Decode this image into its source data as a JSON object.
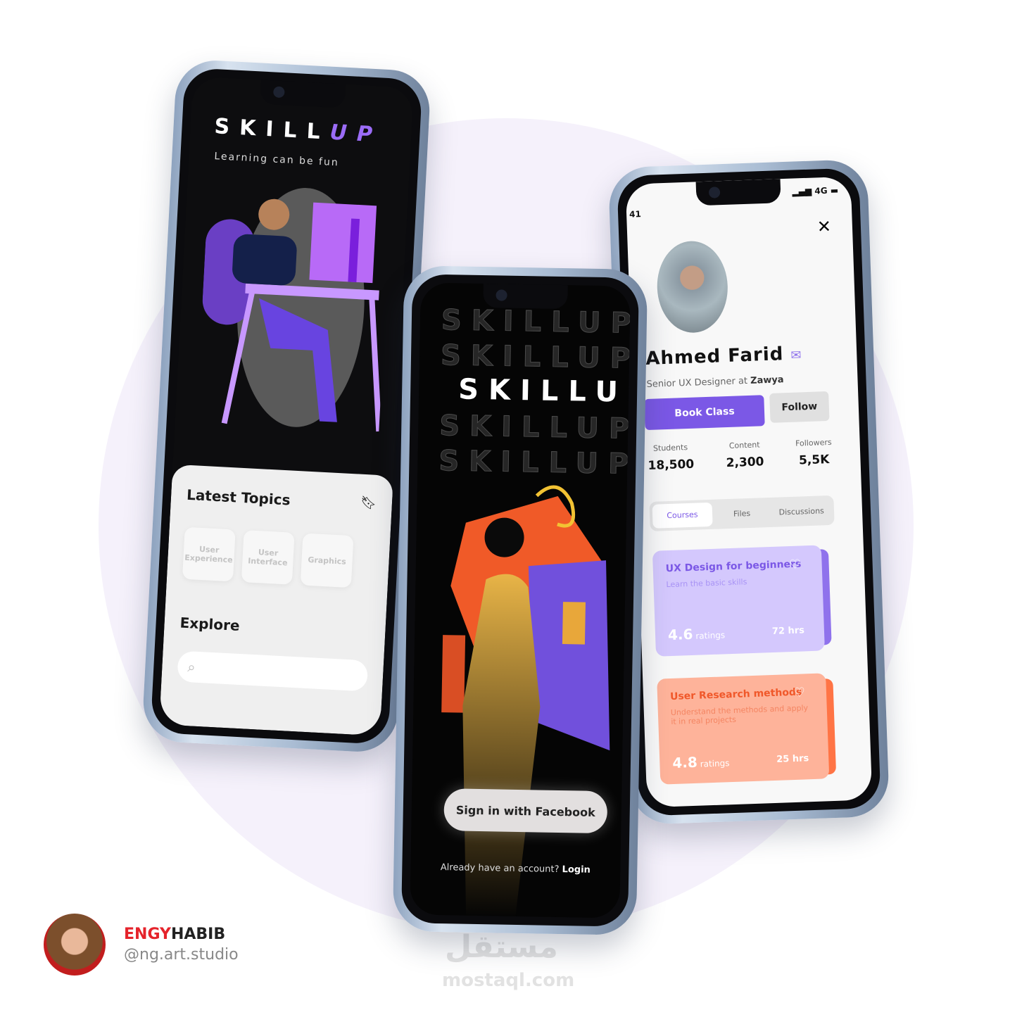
{
  "welcome": {
    "logo_main": "SKILL",
    "logo_accent": "UP",
    "tagline": "Learning can be fun",
    "latest_topics": "Latest Topics",
    "topics": [
      "User Experience",
      "User Interface",
      "Graphics"
    ],
    "explore": "Explore",
    "search_placeholder": ""
  },
  "signin": {
    "logo_main": "SKILL",
    "logo_accent": "UP",
    "ghost": "SKILLUP",
    "facebook": "Sign in with Facebook",
    "already": "Already have an account?",
    "login": "Login"
  },
  "profile": {
    "time": "41",
    "network": "4G",
    "name": "Ahmed Farid",
    "role": "Senior UX Designer at",
    "company": "Zawya",
    "book": "Book Class",
    "follow": "Follow",
    "stats": [
      {
        "label": "Students",
        "value": "18,500"
      },
      {
        "label": "Content",
        "value": "2,300"
      },
      {
        "label": "Followers",
        "value": "5,5K"
      }
    ],
    "tabs": [
      "Courses",
      "Files",
      "Discussions"
    ],
    "courses": [
      {
        "title": "UX Design for beginners",
        "subtitle": "Learn the basic skills",
        "rating": "4.6",
        "rating_label": "ratings",
        "hours": "72 hrs",
        "color": "#d4c8fd",
        "accent": "#8f72ec",
        "text": "#7b58e6"
      },
      {
        "title": "User Research methods",
        "subtitle": "Understand the methods and apply it in real projects",
        "rating": "4.8",
        "rating_label": "ratings",
        "hours": "25 hrs",
        "color": "#feb39a",
        "accent": "#ff7445",
        "text": "#f0582a"
      }
    ]
  },
  "credit": {
    "first": "ENGY",
    "last": "HABIB",
    "handle": "@ng.art.studio"
  },
  "watermark": {
    "arabic": "مستقل",
    "latin": "mostaql.com"
  }
}
